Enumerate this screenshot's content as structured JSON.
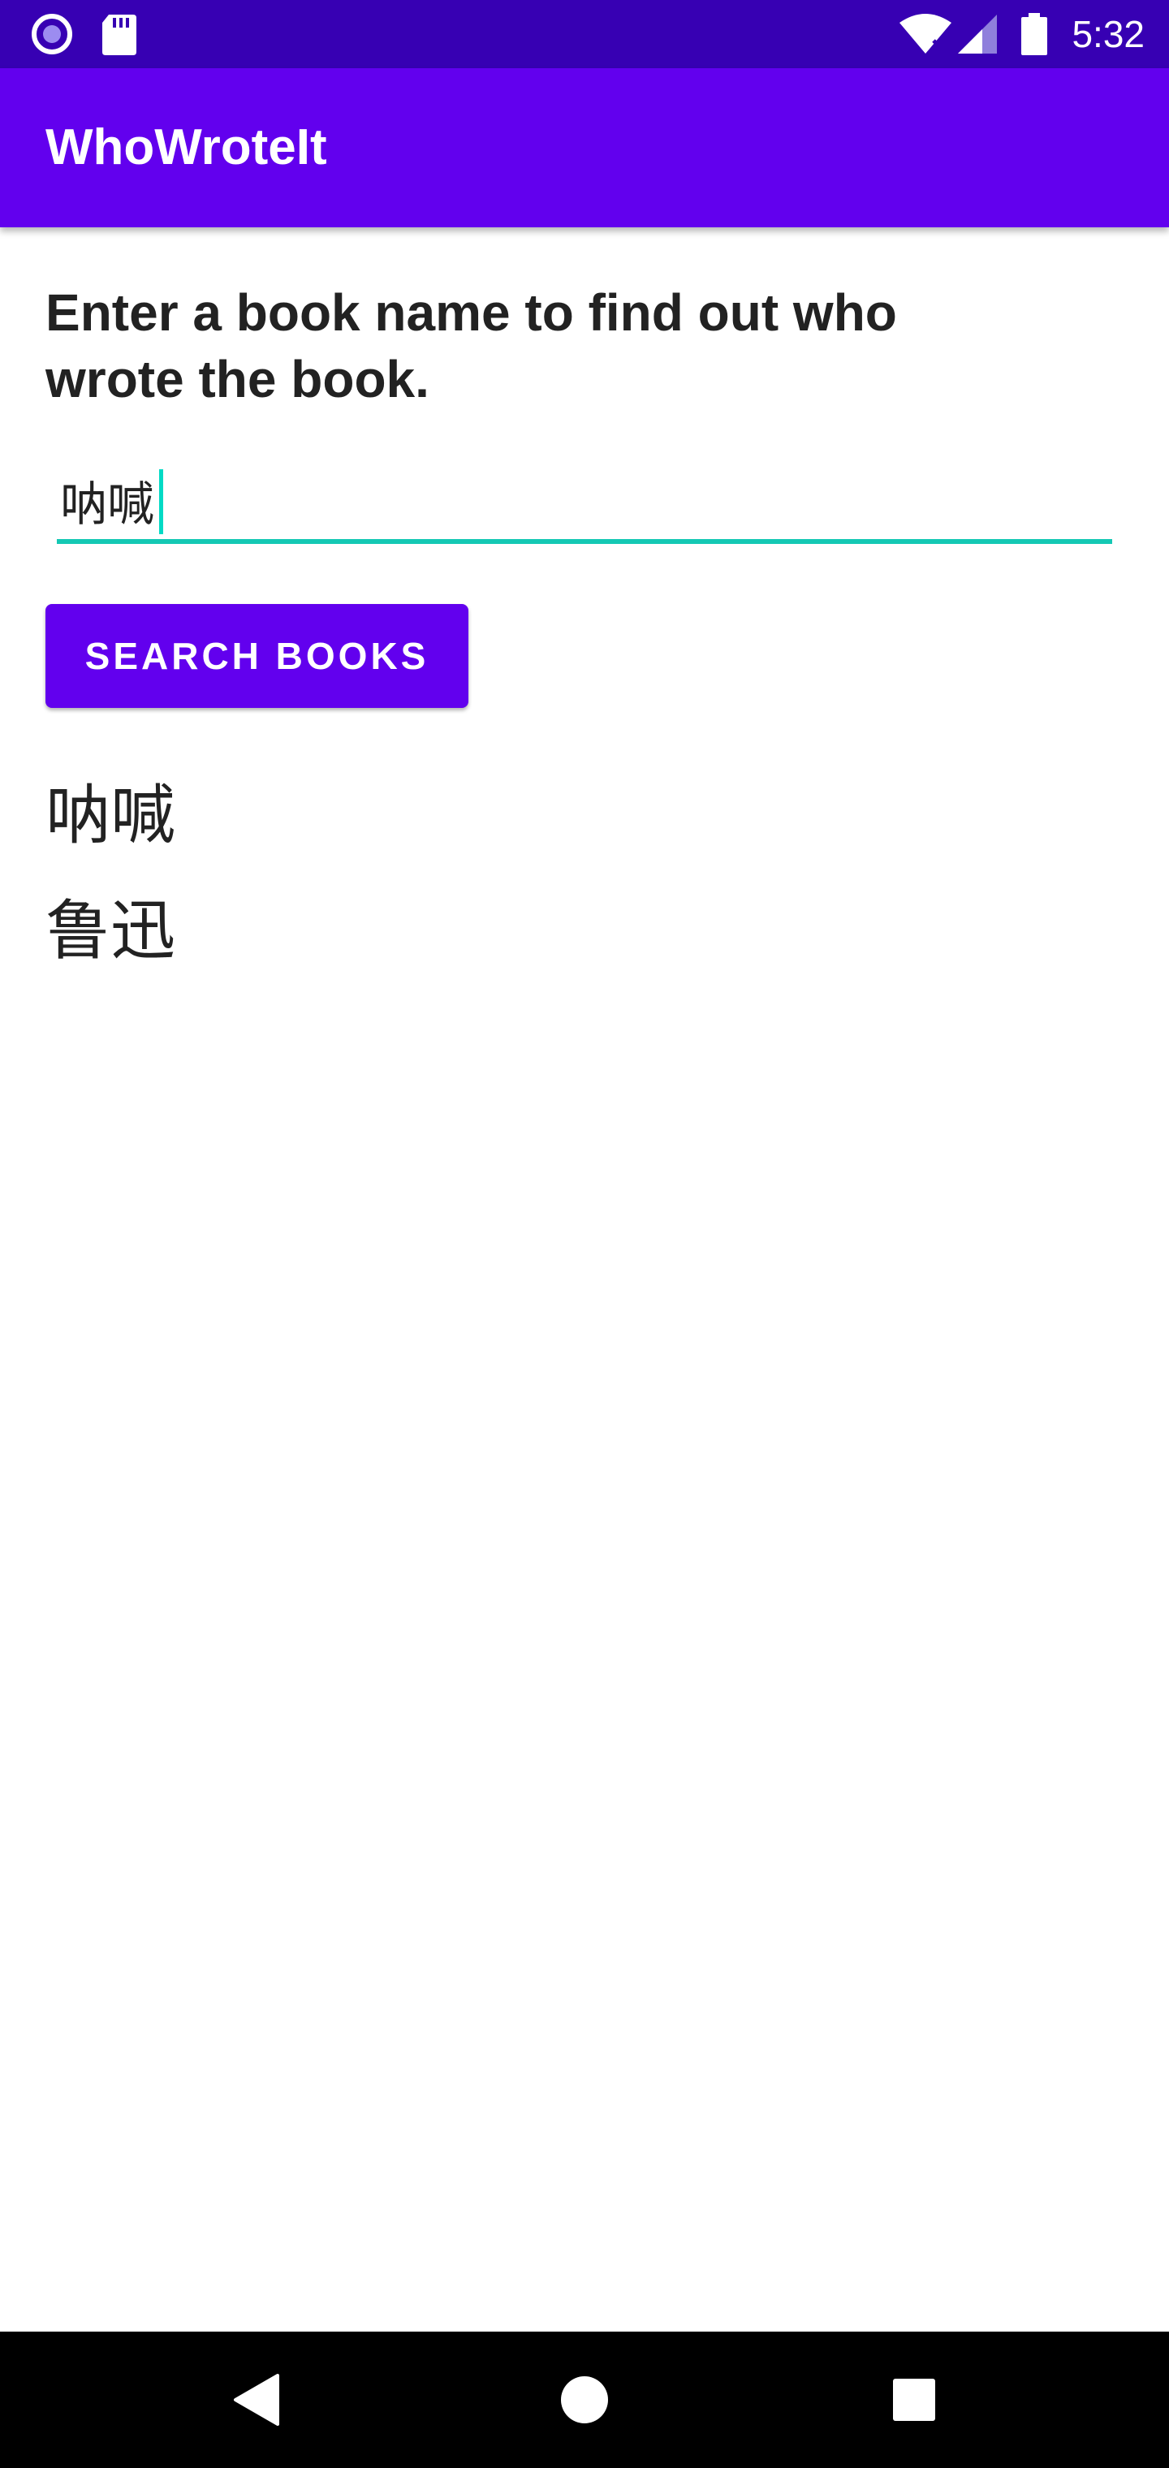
{
  "status_bar": {
    "time": "5:32",
    "icons": [
      "notification-dot-icon",
      "sd-card-icon",
      "wifi-icon",
      "cell-signal-icon",
      "battery-icon"
    ]
  },
  "app_bar": {
    "title": "WhoWroteIt"
  },
  "form": {
    "instructions": "Enter a book name to find out who wrote the book.",
    "book_input_value": "呐喊",
    "search_button_label": "SEARCH BOOKS"
  },
  "result": {
    "title": "呐喊",
    "author": "鲁迅"
  },
  "nav_bar": {
    "icons": [
      "back-icon",
      "home-icon",
      "recents-icon"
    ]
  },
  "colors": {
    "status_bar": "#3700b3",
    "primary": "#6200ee",
    "accent": "#03dac5",
    "text": "#222222",
    "nav_bar": "#000000"
  }
}
